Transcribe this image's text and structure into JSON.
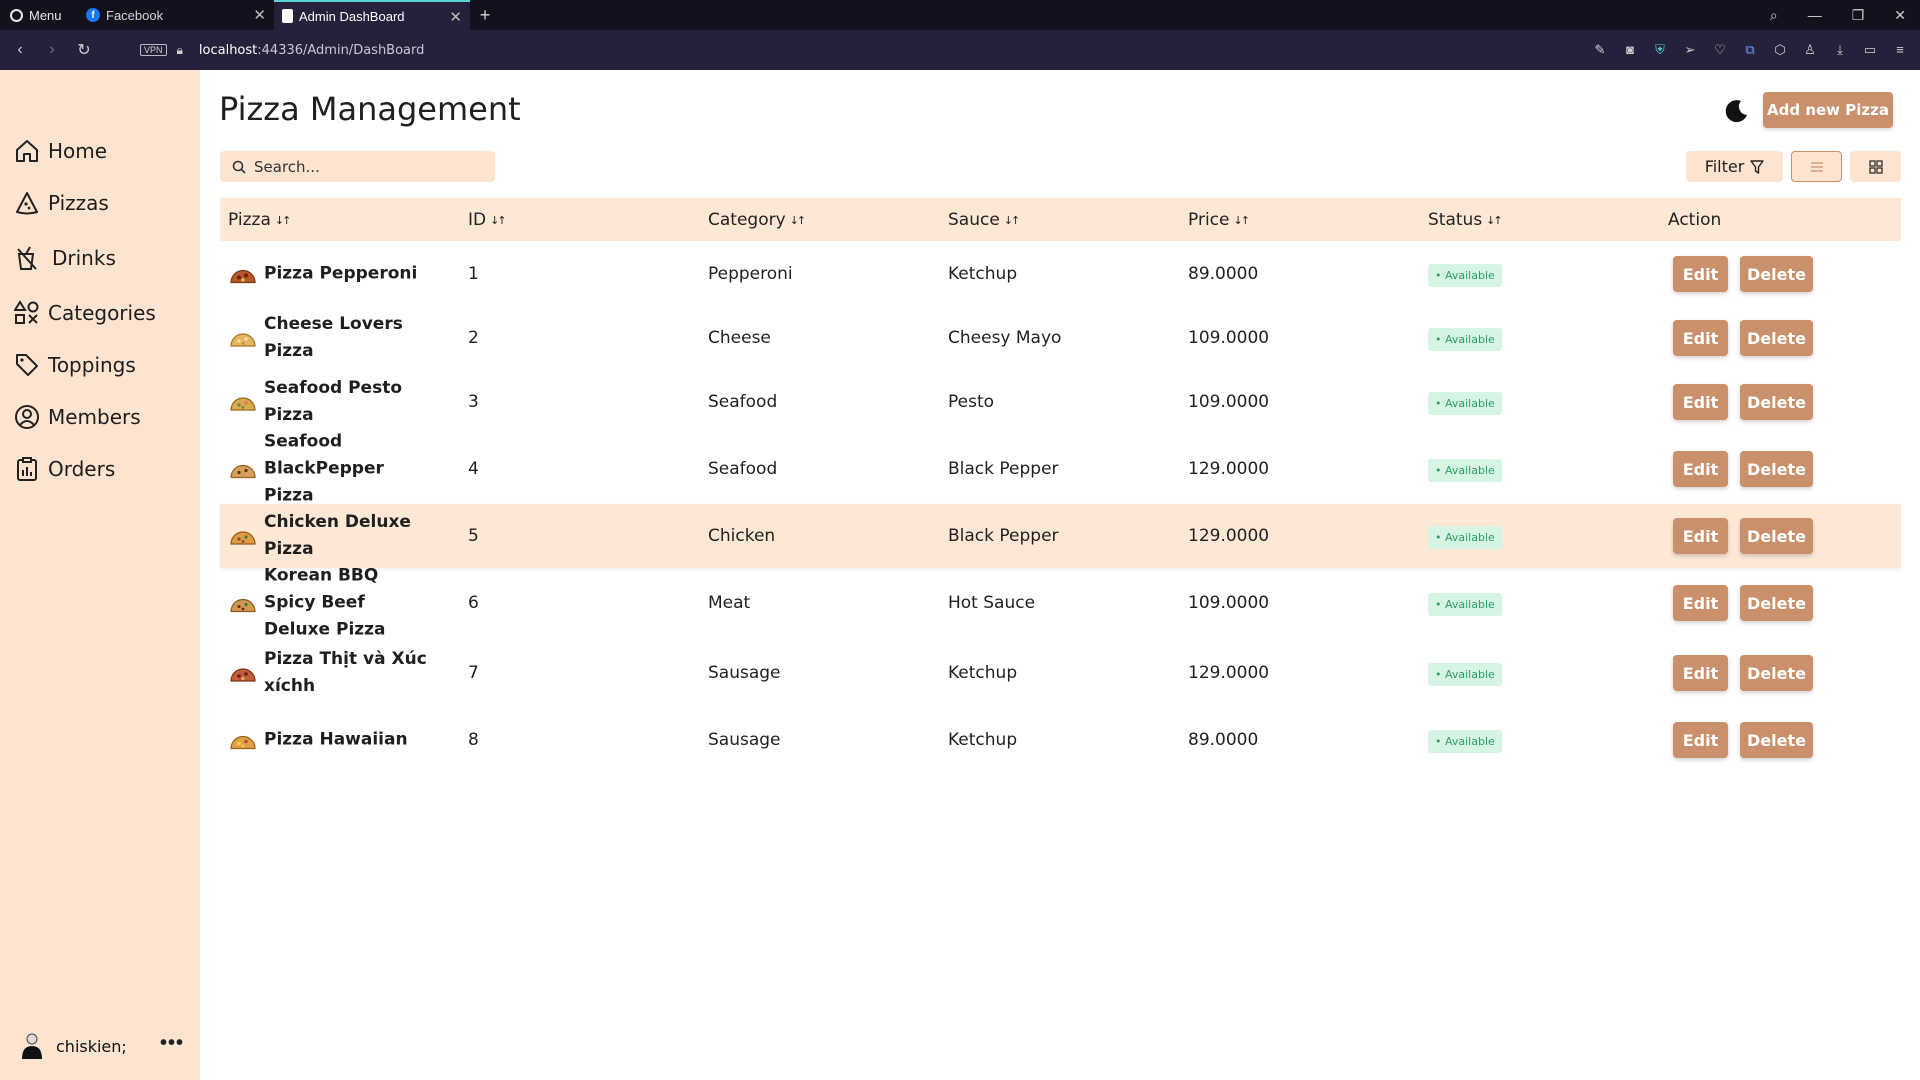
{
  "browser": {
    "menu_label": "Menu",
    "tabs": [
      {
        "title": "Facebook",
        "icon": "facebook-icon"
      },
      {
        "title": "Admin DashBoard",
        "icon": "page-icon"
      }
    ],
    "address": {
      "vpn": "VPN",
      "host": "localhost",
      "rest": ":44336/Admin/DashBoard"
    }
  },
  "sidebar": {
    "items": [
      {
        "label": "Home",
        "icon": "home-icon"
      },
      {
        "label": "Pizzas",
        "icon": "pizza-icon"
      },
      {
        "label": "Drinks",
        "icon": "drink-icon"
      },
      {
        "label": "Categories",
        "icon": "shapes-icon"
      },
      {
        "label": "Toppings",
        "icon": "tag-icon"
      },
      {
        "label": "Members",
        "icon": "user-circle-icon"
      },
      {
        "label": "Orders",
        "icon": "clipboard-icon"
      }
    ],
    "user": {
      "name": "chiskien;",
      "more": "•••"
    }
  },
  "main": {
    "title": "Pizza Management",
    "add_button": "Add new Pizza",
    "search_placeholder": "Search...",
    "filter_label": "Filter",
    "columns": [
      "Pizza",
      "ID",
      "Category",
      "Sauce",
      "Price",
      "Status",
      "Action"
    ],
    "edit_label": "Edit",
    "delete_label": "Delete",
    "rows": [
      {
        "pizza": "Pizza Pepperoni",
        "id": "1",
        "category": "Pepperoni",
        "sauce": "Ketchup",
        "price": "89.0000",
        "status": "• Available"
      },
      {
        "pizza": "Cheese Lovers Pizza",
        "id": "2",
        "category": "Cheese",
        "sauce": "Cheesy Mayo",
        "price": "109.0000",
        "status": "• Available"
      },
      {
        "pizza": "Seafood Pesto Pizza",
        "id": "3",
        "category": "Seafood",
        "sauce": "Pesto",
        "price": "109.0000",
        "status": "• Available"
      },
      {
        "pizza": "Seafood BlackPepper Pizza",
        "id": "4",
        "category": "Seafood",
        "sauce": "Black Pepper",
        "price": "129.0000",
        "status": "• Available"
      },
      {
        "pizza": "Chicken Deluxe Pizza",
        "id": "5",
        "category": "Chicken",
        "sauce": "Black Pepper",
        "price": "129.0000",
        "status": "• Available"
      },
      {
        "pizza": "Korean BBQ Spicy Beef Deluxe Pizza",
        "id": "6",
        "category": "Meat",
        "sauce": "Hot Sauce",
        "price": "109.0000",
        "status": "• Available"
      },
      {
        "pizza": "Pizza Thịt và Xúc xíchh",
        "id": "7",
        "category": "Sausage",
        "sauce": "Ketchup",
        "price": "129.0000",
        "status": "• Available"
      },
      {
        "pizza": "Pizza Hawaiian",
        "id": "8",
        "category": "Sausage",
        "sauce": "Ketchup",
        "price": "89.0000",
        "status": "• Available"
      }
    ]
  },
  "colors": {
    "accent": "#c9906b",
    "sidebar_bg": "#fce4d0",
    "badge_bg": "#d5f4e4",
    "badge_text": "#2e9e62"
  }
}
